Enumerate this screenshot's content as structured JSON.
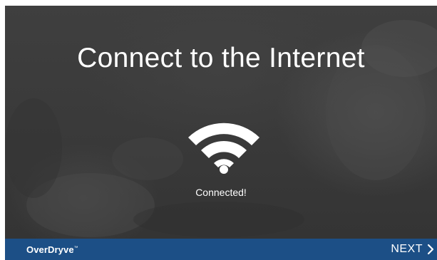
{
  "screen": {
    "title": "Connect to the Internet",
    "status": "Connected!"
  },
  "wifi": {
    "icon": "wifi-icon",
    "state": "connected"
  },
  "footer": {
    "logo_text": "OverDryve",
    "next_label": "NEXT",
    "next_icon": "chevron-right-icon",
    "background_color": "#1c4f86"
  },
  "colors": {
    "background": "#3a3a3a",
    "text": "#ffffff",
    "footer": "#1c4f86"
  }
}
